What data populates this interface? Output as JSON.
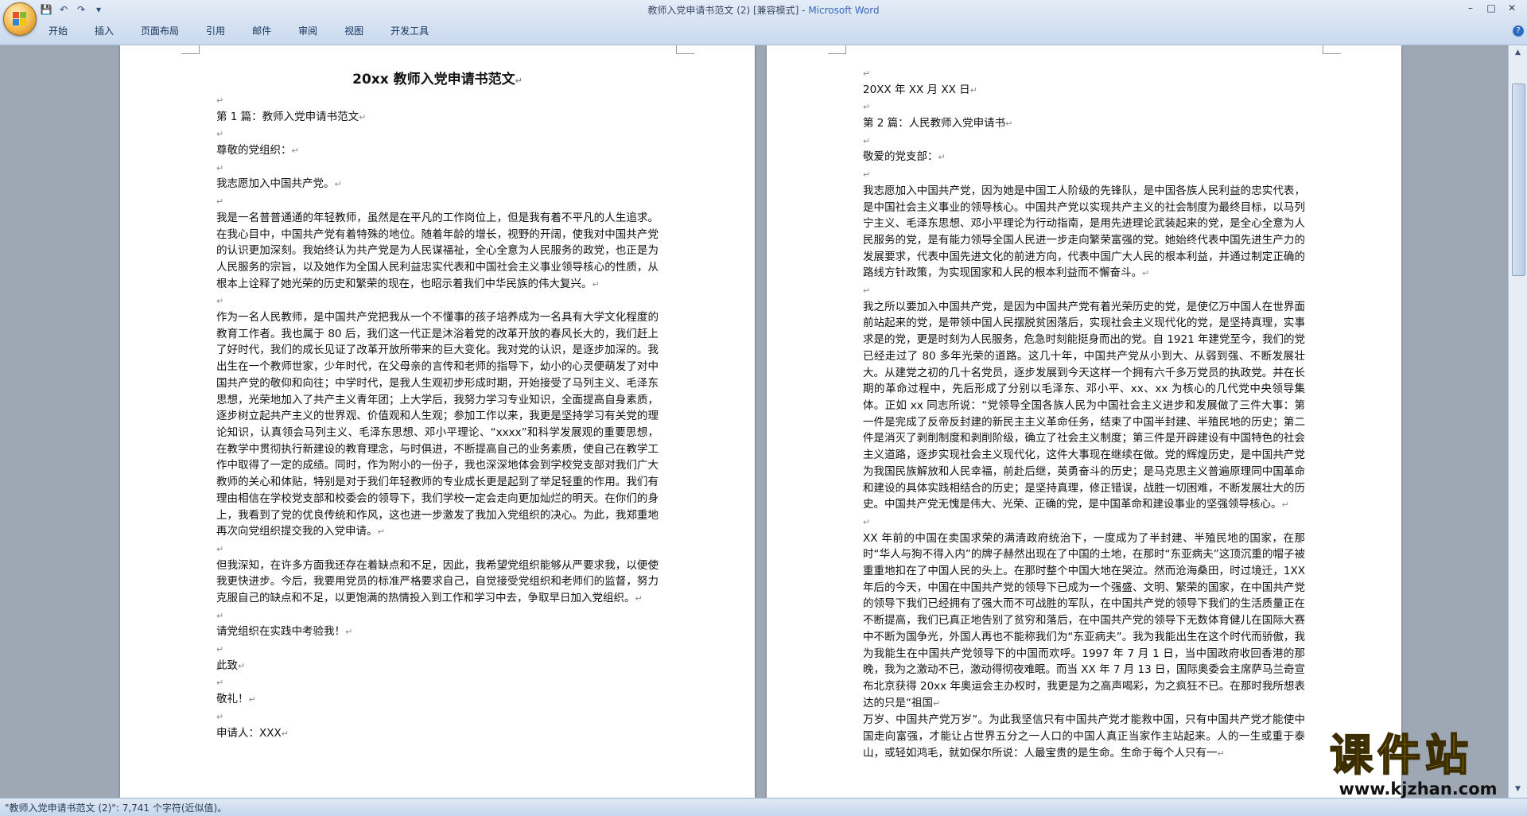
{
  "window": {
    "title": "教师入党申请书范文 (2) [兼容模式] - ",
    "app_name": "Microsoft Word"
  },
  "menu": [
    "开始",
    "插入",
    "页面布局",
    "引用",
    "邮件",
    "审阅",
    "视图",
    "开发工具"
  ],
  "para_mark": "↵",
  "left_page": {
    "title": "20xx 教师入党申请书范文",
    "paragraphs": [
      "",
      "第 1 篇：教师入党申请书范文",
      "",
      "尊敬的党组织：",
      "",
      "我志愿加入中国共产党。",
      "",
      "我是一名普普通通的年轻教师，虽然是在平凡的工作岗位上，但是我有着不平凡的人生追求。在我心目中，中国共产党有着特殊的地位。随着年龄的增长，视野的开阔，使我对中国共产党的认识更加深刻。我始终认为共产党是为人民谋福祉，全心全意为人民服务的政党，也正是为人民服务的宗旨，以及她作为全国人民利益忠实代表和中国社会主义事业领导核心的性质，从根本上诠释了她光荣的历史和繁荣的现在，也昭示着我们中华民族的伟大复兴。",
      "",
      "作为一名人民教师，是中国共产党把我从一个不懂事的孩子培养成为一名具有大学文化程度的教育工作者。我也属于 80 后，我们这一代正是沐浴着党的改革开放的春风长大的，我们赶上了好时代，我们的成长见证了改革开放所带来的巨大变化。我对党的认识，是逐步加深的。我出生在一个教师世家，少年时代，在父母亲的言传和老师的指导下，幼小的心灵便萌发了对中国共产党的敬仰和向往；中学时代，是我人生观初步形成时期，开始接受了马列主义、毛泽东思想，光荣地加入了共产主义青年团；上大学后，我努力学习专业知识，全面提高自身素质，逐步树立起共产主义的世界观、价值观和人生观；参加工作以来，我更是坚持学习有关党的理论知识，认真领会马列主义、毛泽东思想、邓小平理论、“xxxx”和科学发展观的重要思想，在教学中贯彻执行新建设的教育理念，与时俱进，不断提高自己的业务素质，使自己在教学工作中取得了一定的成绩。同时，作为附小的一份子，我也深深地体会到学校党支部对我们广大教师的关心和体贴，特别是对于我们年轻教师的专业成长更是起到了举足轻重的作用。我们有理由相信在学校党支部和校委会的领导下，我们学校一定会走向更加灿烂的明天。在你们的身上，我看到了党的优良传统和作风，这也进一步激发了我加入党组织的决心。为此，我郑重地再次向党组织提交我的入党申请。",
      "",
      "但我深知，在许多方面我还存在着缺点和不足，因此，我希望党组织能够从严要求我，以便使我更快进步。今后，我要用党员的标准严格要求自己，自觉接受党组织和老师们的监督，努力克服自己的缺点和不足，以更饱满的热情投入到工作和学习中去，争取早日加入党组织。",
      "",
      "请党组织在实践中考验我！",
      "",
      "此致",
      "",
      "敬礼！",
      "",
      "申请人：XXX"
    ]
  },
  "right_page": {
    "paragraphs": [
      "",
      "20XX 年 XX 月 XX 日",
      "",
      "第 2 篇：人民教师入党申请书",
      "",
      "敬爱的党支部：",
      "",
      "我志愿加入中国共产党，因为她是中国工人阶级的先锋队，是中国各族人民利益的忠实代表，是中国社会主义事业的领导核心。中国共产党以实现共产主义的社会制度为最终目标，以马列宁主义、毛泽东思想、邓小平理论为行动指南，是用先进理论武装起来的党，是全心全意为人民服务的党，是有能力领导全国人民进一步走向繁荣富强的党。她始终代表中国先进生产力的发展要求，代表中国先进文化的前进方向，代表中国广大人民的根本利益，并通过制定正确的路线方针政策，为实现国家和人民的根本利益而不懈奋斗。",
      "",
      "我之所以要加入中国共产党，是因为中国共产党有着光荣历史的党，是使亿万中国人在世界面前站起来的党，是带领中国人民摆脱贫困落后，实现社会主义现代化的党，是坚持真理，实事求是的党，更是时刻为人民服务，危急时刻能挺身而出的党。自 1921 年建党至今，我们的党已经走过了 80 多年光荣的道路。这几十年，中国共产党从小到大、从弱到强、不断发展壮大。从建党之初的几十名党员，逐步发展到今天这样一个拥有六千多万党员的执政党。并在长期的革命过程中，先后形成了分别以毛泽东、邓小平、xx、xx 为核心的几代党中央领导集体。正如 xx 同志所说：“党领导全国各族人民为中国社会主义进步和发展做了三件大事：第一件是完成了反帝反封建的新民主主义革命任务，结束了中国半封建、半殖民地的历史；第二件是消灭了剥削制度和剥削阶级，确立了社会主义制度；第三件是开辟建设有中国特色的社会主义道路，逐步实现社会主义现代化，这件大事现在继续在做。党的辉煌历史，是中国共产党为我国民族解放和人民幸福，前赴后继，英勇奋斗的历史；是马克思主义普遍原理同中国革命和建设的具体实践相结合的历史；是坚持真理，修正错误，战胜一切困难，不断发展壮大的历史。中国共产党无愧是伟大、光荣、正确的党，是中国革命和建设事业的坚强领导核心。",
      "",
      "XX 年前的中国在卖国求荣的满清政府统治下，一度成为了半封建、半殖民地的国家，在那时“华人与狗不得入内”的牌子赫然出现在了中国的土地，在那时“东亚病夫”这顶沉重的帽子被重重地扣在了中国人民的头上。在那时整个中国大地在哭泣。然而沧海桑田，时过境迁，1XX 年后的今天，中国在中国共产党的领导下已成为一个强盛、文明、繁荣的国家，在中国共产党的领导下我们已经拥有了强大而不可战胜的军队，在中国共产党的领导下我们的生活质量正在不断提高，我们已真正地告别了贫穷和落后，在中国共产党的领导下无数体育健儿在国际大赛中不断为国争光，外国人再也不能称我们为“东亚病夫”。我为我能出生在这个时代而骄傲，我为我能生在中国共产党领导下的中国而欢呼。1997 年 7 月 1 日，当中国政府收回香港的那晚，我为之激动不已，激动得彻夜难眠。而当 XX 年 7 月 13 日，国际奥委会主席萨马兰奇宣布北京获得 20xx 年奥运会主办权时，我更是为之高声喝彩，为之疯狂不已。在那时我所想表达的只是“祖国",
      "万岁、中国共产党万岁”。为此我坚信只有中国共产党才能救中国，只有中国共产党才能使中国走向富强，才能让占世界五分之一人口的中国人真正当家作主站起来。人的一生或重于泰山，或轻如鸿毛，就如保尔所说：人最宝贵的是生命。生命于每个人只有一"
    ]
  },
  "status": {
    "text": "\"教师入党申请书范文 (2)\": 7,741 个字符(近似值)。"
  },
  "watermark": {
    "cn": "课件站",
    "url": "www.kjzhan.com"
  },
  "colors": {
    "titlebar": "#c9d9ee",
    "workspace": "#9ea7b4",
    "app_name": "#3968b7",
    "watermark_yellow": "#f3c600"
  }
}
